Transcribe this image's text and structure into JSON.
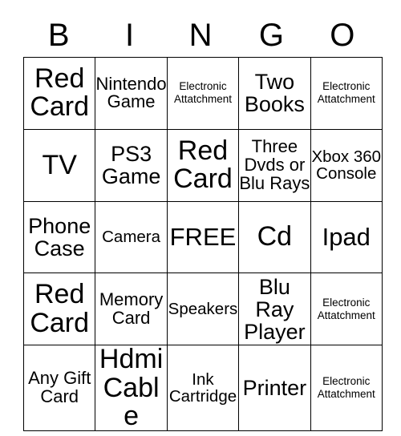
{
  "card": {
    "title": "BINGO",
    "header_letters": [
      "B",
      "I",
      "N",
      "G",
      "O"
    ],
    "free_space_label": "FREE",
    "colors": {
      "background": "#ffffff",
      "border": "#000000",
      "text": "#000000"
    },
    "grid": {
      "columns": 5,
      "rows": 5,
      "cells": [
        [
          {
            "text": "Red Card",
            "size": "sz-xl"
          },
          {
            "text": "Nintendo Game",
            "size": "sz-sm"
          },
          {
            "text": "Electronic Attatchment",
            "size": "sz-tiny"
          },
          {
            "text": "Two Books",
            "size": "sz-md"
          },
          {
            "text": "Electronic Attatchment",
            "size": "sz-tiny"
          }
        ],
        [
          {
            "text": "TV",
            "size": "sz-xl"
          },
          {
            "text": "PS3 Game",
            "size": "sz-md"
          },
          {
            "text": "Red Card",
            "size": "sz-xl"
          },
          {
            "text": "Three Dvds or Blu Rays",
            "size": "sz-sm"
          },
          {
            "text": "Xbox 360 Console",
            "size": "sz-xs"
          }
        ],
        [
          {
            "text": "Phone Case",
            "size": "sz-md"
          },
          {
            "text": "Camera",
            "size": "sz-xs"
          },
          {
            "text": "FREE",
            "size": "sz-lg"
          },
          {
            "text": "Cd",
            "size": "sz-xl"
          },
          {
            "text": "Ipad",
            "size": "sz-lg"
          }
        ],
        [
          {
            "text": "Red Card",
            "size": "sz-xl"
          },
          {
            "text": "Memory Card",
            "size": "sz-sm"
          },
          {
            "text": "Speakers",
            "size": "sz-xs"
          },
          {
            "text": "Blu Ray Player",
            "size": "sz-md"
          },
          {
            "text": "Electronic Attatchment",
            "size": "sz-tiny"
          }
        ],
        [
          {
            "text": "Any Gift Card",
            "size": "sz-sm"
          },
          {
            "text": "Hdmi Cable",
            "size": "sz-xl"
          },
          {
            "text": "Ink Cartridge",
            "size": "sz-xs"
          },
          {
            "text": "Printer",
            "size": "sz-md"
          },
          {
            "text": "Electronic Attatchment",
            "size": "sz-tiny"
          }
        ]
      ]
    }
  }
}
